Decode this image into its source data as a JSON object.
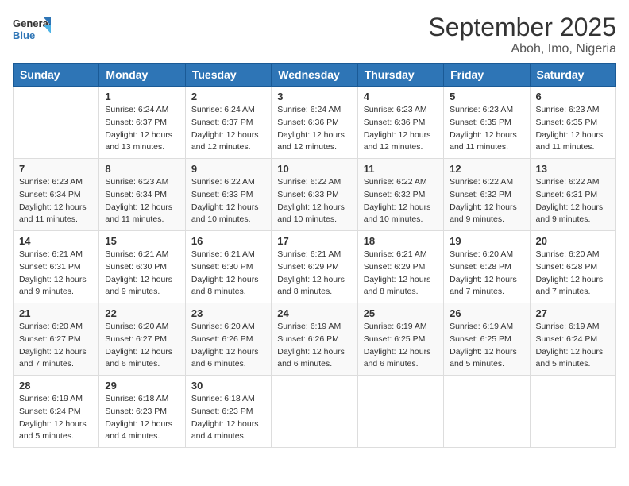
{
  "logo": {
    "line1": "General",
    "line2": "Blue"
  },
  "title": "September 2025",
  "subtitle": "Aboh, Imo, Nigeria",
  "days_of_week": [
    "Sunday",
    "Monday",
    "Tuesday",
    "Wednesday",
    "Thursday",
    "Friday",
    "Saturday"
  ],
  "weeks": [
    [
      {
        "day": "",
        "info": ""
      },
      {
        "day": "1",
        "info": "Sunrise: 6:24 AM\nSunset: 6:37 PM\nDaylight: 12 hours\nand 13 minutes."
      },
      {
        "day": "2",
        "info": "Sunrise: 6:24 AM\nSunset: 6:37 PM\nDaylight: 12 hours\nand 12 minutes."
      },
      {
        "day": "3",
        "info": "Sunrise: 6:24 AM\nSunset: 6:36 PM\nDaylight: 12 hours\nand 12 minutes."
      },
      {
        "day": "4",
        "info": "Sunrise: 6:23 AM\nSunset: 6:36 PM\nDaylight: 12 hours\nand 12 minutes."
      },
      {
        "day": "5",
        "info": "Sunrise: 6:23 AM\nSunset: 6:35 PM\nDaylight: 12 hours\nand 11 minutes."
      },
      {
        "day": "6",
        "info": "Sunrise: 6:23 AM\nSunset: 6:35 PM\nDaylight: 12 hours\nand 11 minutes."
      }
    ],
    [
      {
        "day": "7",
        "info": "Sunrise: 6:23 AM\nSunset: 6:34 PM\nDaylight: 12 hours\nand 11 minutes."
      },
      {
        "day": "8",
        "info": "Sunrise: 6:23 AM\nSunset: 6:34 PM\nDaylight: 12 hours\nand 11 minutes."
      },
      {
        "day": "9",
        "info": "Sunrise: 6:22 AM\nSunset: 6:33 PM\nDaylight: 12 hours\nand 10 minutes."
      },
      {
        "day": "10",
        "info": "Sunrise: 6:22 AM\nSunset: 6:33 PM\nDaylight: 12 hours\nand 10 minutes."
      },
      {
        "day": "11",
        "info": "Sunrise: 6:22 AM\nSunset: 6:32 PM\nDaylight: 12 hours\nand 10 minutes."
      },
      {
        "day": "12",
        "info": "Sunrise: 6:22 AM\nSunset: 6:32 PM\nDaylight: 12 hours\nand 9 minutes."
      },
      {
        "day": "13",
        "info": "Sunrise: 6:22 AM\nSunset: 6:31 PM\nDaylight: 12 hours\nand 9 minutes."
      }
    ],
    [
      {
        "day": "14",
        "info": "Sunrise: 6:21 AM\nSunset: 6:31 PM\nDaylight: 12 hours\nand 9 minutes."
      },
      {
        "day": "15",
        "info": "Sunrise: 6:21 AM\nSunset: 6:30 PM\nDaylight: 12 hours\nand 9 minutes."
      },
      {
        "day": "16",
        "info": "Sunrise: 6:21 AM\nSunset: 6:30 PM\nDaylight: 12 hours\nand 8 minutes."
      },
      {
        "day": "17",
        "info": "Sunrise: 6:21 AM\nSunset: 6:29 PM\nDaylight: 12 hours\nand 8 minutes."
      },
      {
        "day": "18",
        "info": "Sunrise: 6:21 AM\nSunset: 6:29 PM\nDaylight: 12 hours\nand 8 minutes."
      },
      {
        "day": "19",
        "info": "Sunrise: 6:20 AM\nSunset: 6:28 PM\nDaylight: 12 hours\nand 7 minutes."
      },
      {
        "day": "20",
        "info": "Sunrise: 6:20 AM\nSunset: 6:28 PM\nDaylight: 12 hours\nand 7 minutes."
      }
    ],
    [
      {
        "day": "21",
        "info": "Sunrise: 6:20 AM\nSunset: 6:27 PM\nDaylight: 12 hours\nand 7 minutes."
      },
      {
        "day": "22",
        "info": "Sunrise: 6:20 AM\nSunset: 6:27 PM\nDaylight: 12 hours\nand 6 minutes."
      },
      {
        "day": "23",
        "info": "Sunrise: 6:20 AM\nSunset: 6:26 PM\nDaylight: 12 hours\nand 6 minutes."
      },
      {
        "day": "24",
        "info": "Sunrise: 6:19 AM\nSunset: 6:26 PM\nDaylight: 12 hours\nand 6 minutes."
      },
      {
        "day": "25",
        "info": "Sunrise: 6:19 AM\nSunset: 6:25 PM\nDaylight: 12 hours\nand 6 minutes."
      },
      {
        "day": "26",
        "info": "Sunrise: 6:19 AM\nSunset: 6:25 PM\nDaylight: 12 hours\nand 5 minutes."
      },
      {
        "day": "27",
        "info": "Sunrise: 6:19 AM\nSunset: 6:24 PM\nDaylight: 12 hours\nand 5 minutes."
      }
    ],
    [
      {
        "day": "28",
        "info": "Sunrise: 6:19 AM\nSunset: 6:24 PM\nDaylight: 12 hours\nand 5 minutes."
      },
      {
        "day": "29",
        "info": "Sunrise: 6:18 AM\nSunset: 6:23 PM\nDaylight: 12 hours\nand 4 minutes."
      },
      {
        "day": "30",
        "info": "Sunrise: 6:18 AM\nSunset: 6:23 PM\nDaylight: 12 hours\nand 4 minutes."
      },
      {
        "day": "",
        "info": ""
      },
      {
        "day": "",
        "info": ""
      },
      {
        "day": "",
        "info": ""
      },
      {
        "day": "",
        "info": ""
      }
    ]
  ]
}
